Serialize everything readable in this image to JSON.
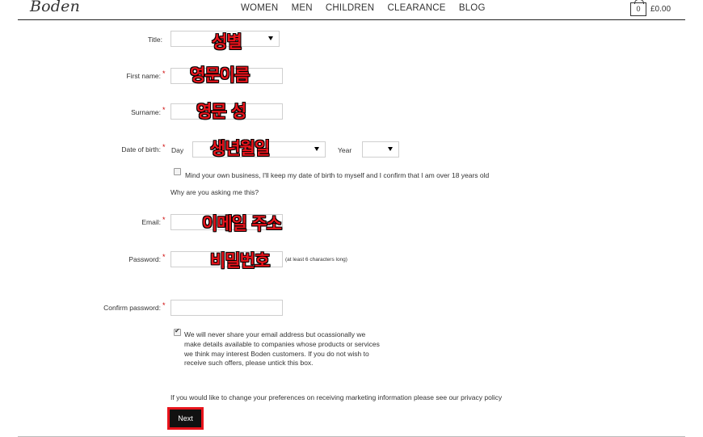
{
  "header": {
    "logo": "Boden",
    "nav": [
      "WOMEN",
      "MEN",
      "CHILDREN",
      "CLEARANCE",
      "BLOG"
    ],
    "basket_count": "0",
    "basket_total": "£0.00"
  },
  "form": {
    "title_label": "Title:",
    "first_name_label": "First name:",
    "surname_label": "Surname:",
    "dob_label": "Date of birth:",
    "day_label": "Day",
    "year_label": "Year",
    "dob_privacy_text": "Mind your own business, I'll keep my date of birth to myself and I confirm that I am over 18 years old",
    "why_link": "Why are you asking me this?",
    "email_label": "Email:",
    "password_label": "Password:",
    "password_hint": "(at least 6 characters long)",
    "confirm_password_label": "Confirm password:",
    "marketing_text": "We will never share your email address but ocassionally we make details available to companies whose products or services we think may interest Boden customers. If you do not wish to receive such offers, please untick this box.",
    "preferences_text": "If you would like to change your preferences on receiving marketing information please see our privacy policy",
    "required_mark": "*",
    "next_button": "Next"
  },
  "annotations": {
    "title": "성별",
    "first_name": "영문이름",
    "surname": "영문 성",
    "dob": "생년월일",
    "email": "이메일 주소",
    "password": "비밀번호"
  },
  "colors": {
    "annotation_red": "#e8141c",
    "required_red": "#cc0000",
    "button_bg": "#111111"
  }
}
